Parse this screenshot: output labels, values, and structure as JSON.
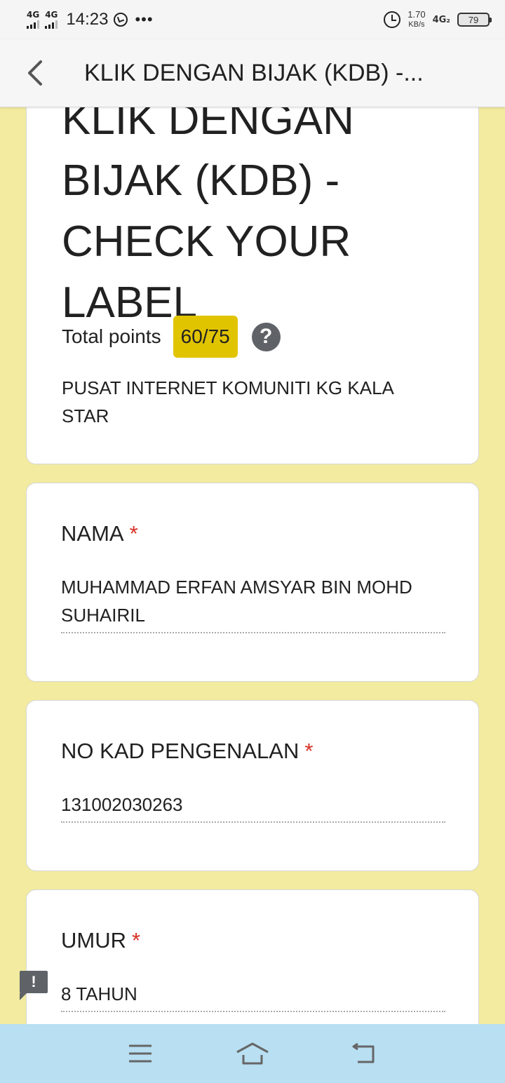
{
  "status_bar": {
    "sim1_network": "4G",
    "sim2_network": "4G",
    "time": "14:23",
    "more_indicator": "•••",
    "speed_value": "1.70",
    "speed_unit": "KB/s",
    "network_type": "4G₂",
    "battery_level": "79",
    "icons": [
      "signal-icon",
      "whatsapp-icon",
      "alarm-icon",
      "battery-icon"
    ]
  },
  "app_bar": {
    "title": "KLIK DENGAN BIJAK (KDB) -..."
  },
  "form_header": {
    "title": "KLIK DENGAN BIJAK (KDB) - CHECK YOUR LABEL",
    "total_points_label": "Total points",
    "score": "60/75",
    "help_symbol": "?",
    "description": "PUSAT INTERNET KOMUNITI KG KALA STAR",
    "score_badge_color": "#e1c400"
  },
  "questions": [
    {
      "label": "NAMA",
      "required_mark": "*",
      "answer": "MUHAMMAD ERFAN AMSYAR BIN MOHD SUHAIRIL"
    },
    {
      "label": "NO KAD PENGENALAN",
      "required_mark": "*",
      "answer": "131002030263"
    },
    {
      "label": "UMUR",
      "required_mark": "*",
      "answer": "8 TAHUN"
    }
  ],
  "feedback": {
    "symbol": "!"
  },
  "nav_bar": {
    "icons": [
      "menu-icon",
      "home-icon",
      "back-nav-icon"
    ]
  },
  "colors": {
    "page_background": "#f2eba0",
    "required": "#d93025",
    "nav_bar": "#b8dff2"
  }
}
